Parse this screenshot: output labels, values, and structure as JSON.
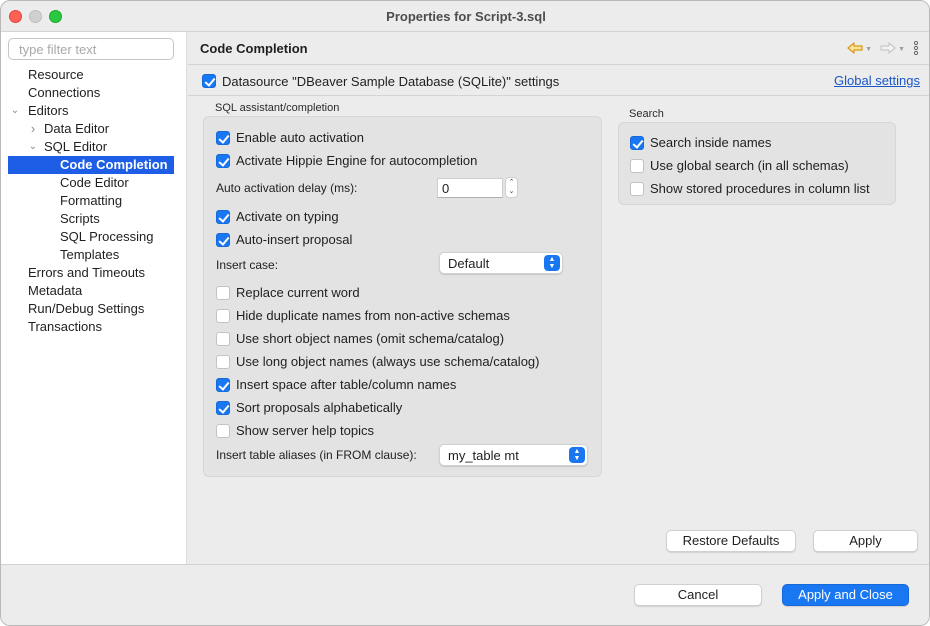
{
  "window": {
    "title": "Properties for Script-3.sql",
    "controls": {
      "close": "close",
      "minimize": "minimize",
      "maximize": "maximize"
    }
  },
  "sidebar": {
    "filter_placeholder": "type filter text",
    "filter_value": "",
    "items": [
      {
        "label": "Resource",
        "level": 0,
        "expander": ""
      },
      {
        "label": "Connections",
        "level": 0,
        "expander": ""
      },
      {
        "label": "Editors",
        "level": 0,
        "expander": "expanded"
      },
      {
        "label": "Data Editor",
        "level": 1,
        "expander": "collapsed"
      },
      {
        "label": "SQL Editor",
        "level": 1,
        "expander": "expanded"
      },
      {
        "label": "Code Completion",
        "level": 2,
        "expander": "",
        "selected": true
      },
      {
        "label": "Code Editor",
        "level": 2,
        "expander": ""
      },
      {
        "label": "Formatting",
        "level": 2,
        "expander": ""
      },
      {
        "label": "Scripts",
        "level": 2,
        "expander": ""
      },
      {
        "label": "SQL Processing",
        "level": 2,
        "expander": ""
      },
      {
        "label": "Templates",
        "level": 2,
        "expander": ""
      },
      {
        "label": "Errors and Timeouts",
        "level": 0,
        "expander": ""
      },
      {
        "label": "Metadata",
        "level": 0,
        "expander": ""
      },
      {
        "label": "Run/Debug Settings",
        "level": 0,
        "expander": ""
      },
      {
        "label": "Transactions",
        "level": 0,
        "expander": ""
      }
    ]
  },
  "header": {
    "title": "Code Completion",
    "icons": [
      "back-arrow-icon",
      "forward-arrow-icon",
      "more-options-icon"
    ]
  },
  "datasource": {
    "checked": true,
    "label": "Datasource \"DBeaver Sample Database (SQLite)\" settings",
    "global_link": "Global settings"
  },
  "sql_assistant": {
    "title": "SQL assistant/completion",
    "enable_auto_activation": {
      "label": "Enable auto activation",
      "checked": true
    },
    "hippie_engine": {
      "label": "Activate Hippie Engine for autocompletion",
      "checked": true
    },
    "delay_label": "Auto activation delay (ms):",
    "delay_value": "0",
    "activate_on_typing": {
      "label": "Activate on typing",
      "checked": true
    },
    "auto_insert": {
      "label": "Auto-insert proposal",
      "checked": true
    },
    "insert_case_label": "Insert case:",
    "insert_case_value": "Default",
    "options": [
      {
        "label": "Replace current word",
        "checked": false
      },
      {
        "label": "Hide duplicate names from non-active schemas",
        "checked": false
      },
      {
        "label": "Use short object names (omit schema/catalog)",
        "checked": false
      },
      {
        "label": "Use long object names (always use schema/catalog)",
        "checked": false
      },
      {
        "label": "Insert space after table/column names",
        "checked": true
      },
      {
        "label": "Sort proposals alphabetically",
        "checked": true
      },
      {
        "label": "Show server help topics",
        "checked": false
      }
    ],
    "aliases_label": "Insert table aliases (in FROM clause):",
    "aliases_value": "my_table mt"
  },
  "search": {
    "title": "Search",
    "options": [
      {
        "label": "Search inside names",
        "checked": true
      },
      {
        "label": "Use global search (in all schemas)",
        "checked": false
      },
      {
        "label": "Show stored procedures in column list",
        "checked": false
      }
    ]
  },
  "buttons": {
    "restore_defaults": "Restore Defaults",
    "apply": "Apply",
    "cancel": "Cancel",
    "apply_and_close": "Apply and Close"
  },
  "colors": {
    "accent": "#1a77f2",
    "selection": "#1e5ee6",
    "link": "#1a57c7",
    "back_arrow": "#e8a317"
  }
}
